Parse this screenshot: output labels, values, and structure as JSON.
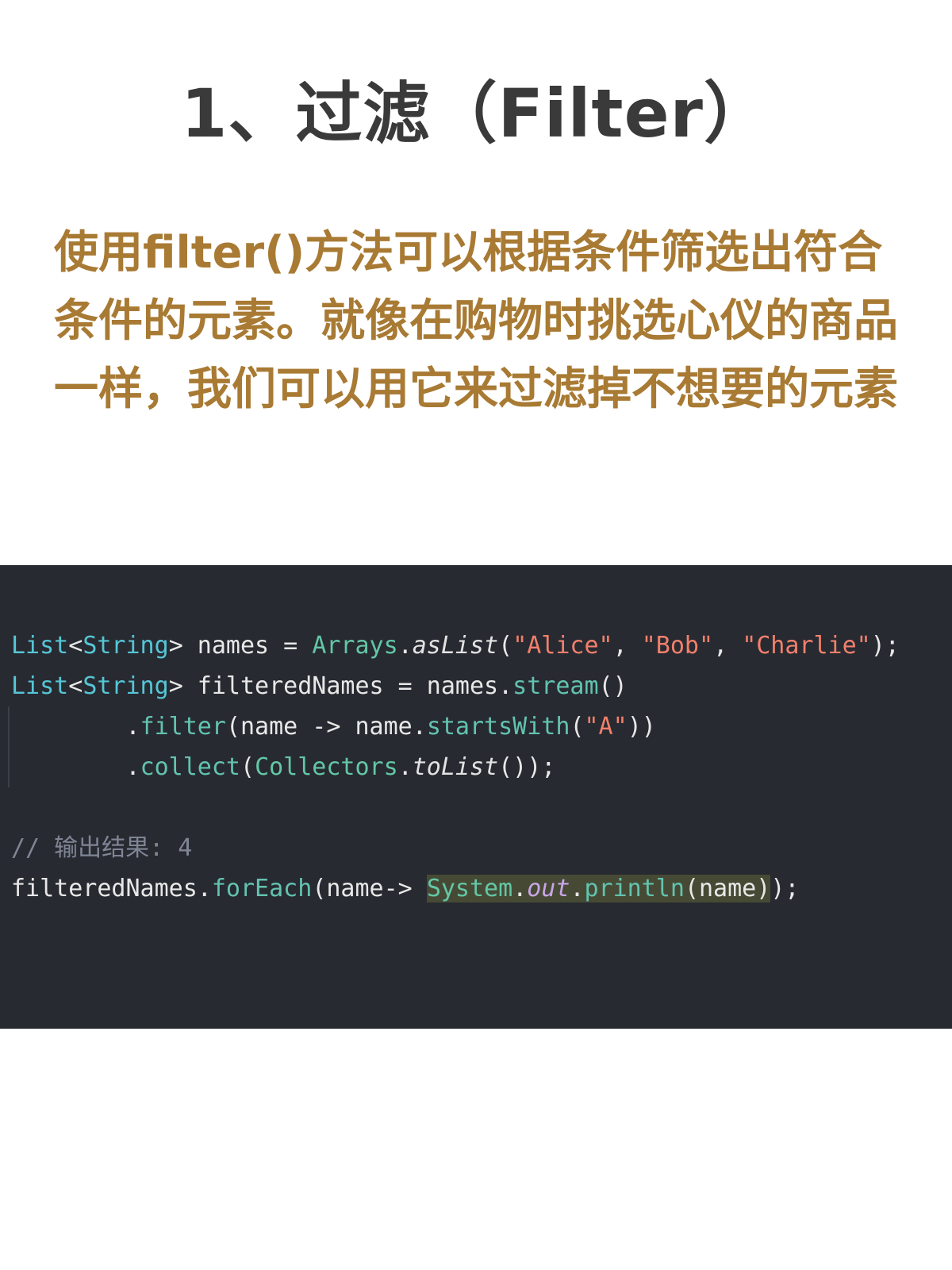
{
  "title": "1、过滤（Filter）",
  "description": "使用filter()方法可以根据条件筛选出符合条件的元素。就像在购物时挑选心仪的商品一样，我们可以用它来过滤掉不想要的元素",
  "colors": {
    "title": "#3a3a3a",
    "description": "#a87a33",
    "code_background": "#282a31"
  },
  "code": {
    "line1": {
      "type1": "List",
      "lt1": "<",
      "type2": "String",
      "gt1": ">",
      "rest1": " names = ",
      "class1": "Arrays",
      "dot1": ".",
      "method1": "asList",
      "paren1": "(",
      "str1": "\"Alice\"",
      "comma1": ", ",
      "str2": "\"Bob\"",
      "comma2": ", ",
      "str3": "\"Charlie\"",
      "end1": ");"
    },
    "line2": {
      "type1": "List",
      "lt1": "<",
      "type2": "String",
      "gt1": ">",
      "rest1": " filteredNames = names.",
      "method1": "stream",
      "end1": "()"
    },
    "line3": {
      "indent": "        .",
      "method1": "filter",
      "rest1": "(name -> name.",
      "method2": "startsWith",
      "paren1": "(",
      "str1": "\"A\"",
      "end1": "))"
    },
    "line4": {
      "indent": "        .",
      "method1": "collect",
      "paren1": "(",
      "class1": "Collectors",
      "dot1": ".",
      "static1": "toList",
      "end1": "());"
    },
    "line5": {
      "text": ""
    },
    "line6": {
      "comment": "// 输出结果: 4"
    },
    "line7": {
      "rest1": "filteredNames.",
      "method1": "forEach",
      "rest2": "(name-> ",
      "class1": "System",
      "dot1": ".",
      "field1": "out",
      "dot2": ".",
      "method2": "println",
      "paren1": "(name)",
      "end1": ");"
    }
  }
}
